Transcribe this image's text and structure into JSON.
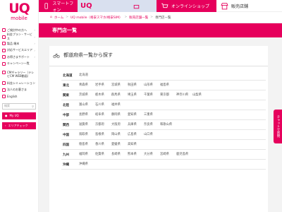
{
  "brand": {
    "logo_main": "UQ",
    "logo_sub": "mobile"
  },
  "topbar": {
    "smartphone": "スマートフォン",
    "uq_wimax_logo": "UQ",
    "mobile_net": "モバイルネット",
    "online_shop": "オンラインショップ",
    "store": "販売店舗"
  },
  "breadcrumb": {
    "items": [
      "ホーム",
      "UQ mobile（格安スマホ/格安SIM）",
      "販売店舗一覧",
      "専門店一覧"
    ],
    "separator": ">"
  },
  "sidebar": {
    "items": [
      {
        "label": "ご検討中の方へ",
        "icon": "person-icon"
      },
      {
        "label": "料金プラン・サービス",
        "icon": "yen-icon"
      },
      {
        "label": "製品 端末",
        "icon": "phone-icon"
      },
      {
        "label": "対応サービスエリア",
        "icon": "map-pin-icon"
      },
      {
        "label": "お得さまサポート",
        "icon": "support-icon"
      },
      {
        "label": "キャンペーン一覧",
        "icon": "megaphone-icon"
      },
      {
        "label": "CMギャラリー（テレビCM WEB動画）",
        "icon": "tv-icon"
      },
      {
        "label": "料金シミュレーション",
        "icon": "calculator-icon"
      },
      {
        "label": "法人のお客さま",
        "icon": "building-icon"
      },
      {
        "label": "English",
        "icon": "globe-icon"
      }
    ],
    "search_placeholder": "検索",
    "my_uq_label": "My UQ",
    "area_link_label": "エリアチェック"
  },
  "main": {
    "page_title": "専門店一覧",
    "section_heading": "都道府県一覧から探す",
    "regions": [
      {
        "name": "北海道",
        "prefs": [
          "北海道"
        ]
      },
      {
        "name": "東北",
        "prefs": [
          "青森県",
          "岩手県",
          "宮城県",
          "秋田県",
          "山形県",
          "福島県"
        ]
      },
      {
        "name": "関東",
        "prefs": [
          "茨城県",
          "栃木県",
          "群馬県",
          "埼玉県",
          "千葉県",
          "東京都",
          "神奈川県",
          "山梨県"
        ]
      },
      {
        "name": "北陸",
        "prefs": [
          "富山県",
          "石川県",
          "福井県"
        ]
      },
      {
        "name": "中部",
        "prefs": [
          "長野県",
          "岐阜県",
          "静岡県",
          "愛知県",
          "三重県"
        ]
      },
      {
        "name": "関西",
        "prefs": [
          "滋賀県",
          "京都府",
          "大阪府",
          "兵庫県",
          "奈良県",
          "和歌山県"
        ]
      },
      {
        "name": "中国",
        "prefs": [
          "鳥取県",
          "島根県",
          "岡山県",
          "広島県",
          "山口県"
        ]
      },
      {
        "name": "四国",
        "prefs": [
          "徳島県",
          "香川県",
          "愛媛県",
          "高知県"
        ]
      },
      {
        "name": "九州",
        "prefs": [
          "福岡県",
          "佐賀県",
          "長崎県",
          "熊本県",
          "大分県",
          "宮崎県",
          "鹿児島県"
        ]
      },
      {
        "name": "沖縄",
        "prefs": [
          "沖縄県"
        ]
      }
    ]
  },
  "chat_tab": {
    "label": "チャットで質問"
  },
  "colors": {
    "accent": "#e6005c",
    "wimax_bg": "#d9e0ef",
    "page_bg": "#f3f3f3"
  }
}
